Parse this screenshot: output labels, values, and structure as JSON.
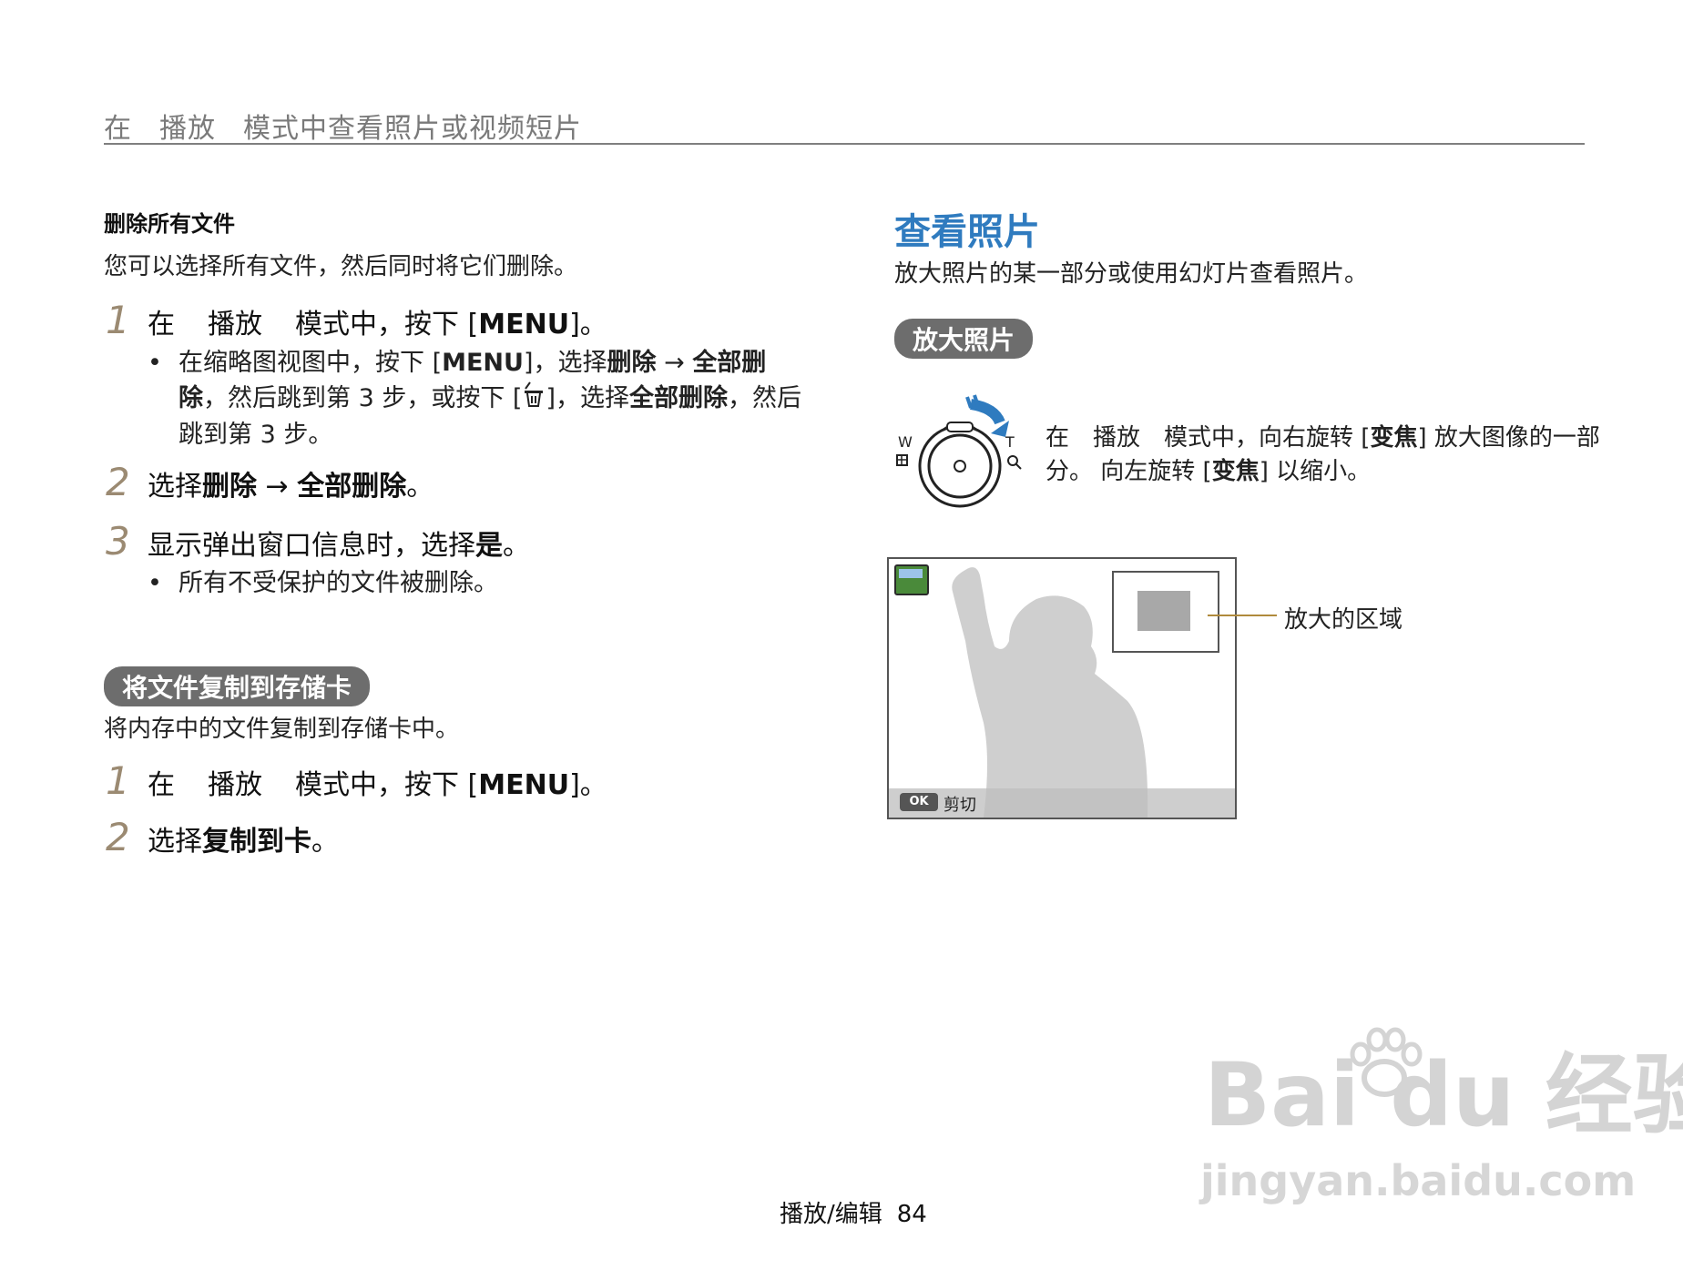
{
  "header": {
    "part1": "在",
    "part2": "播放",
    "part3": "模式中查看照片或视频短片"
  },
  "left": {
    "delete_all": {
      "title": "删除所有文件",
      "desc": "您可以选择所有文件，然后同时将它们删除。",
      "step1": {
        "num": "1",
        "pre": "在",
        "mode": "播放",
        "mid": "模式中，按下 [",
        "key": "MENU",
        "post": "]。"
      },
      "step1_bullet": {
        "l1_a": "在缩略图视图中，按下 [",
        "l1_key": "MENU",
        "l1_b": "]，选择",
        "l1_c": "删除",
        "l1_arrow": " → ",
        "l1_d": "全部删",
        "l2_a": "除",
        "l2_b": "，然后跳到第 3 步，或按下 [",
        "l2_c": "]，选择",
        "l2_d": "全部删除",
        "l2_e": "，然后",
        "l3": "跳到第 3 步。"
      },
      "step2": {
        "num": "2",
        "pre": "选择",
        "a": "删除",
        "arrow": " → ",
        "b": "全部删除",
        "post": "。"
      },
      "step3": {
        "num": "3",
        "pre": "显示弹出窗口信息时，选择",
        "a": "是",
        "post": "。"
      },
      "step3_bullet": "所有不受保护的文件被删除。"
    },
    "copy": {
      "pill": "将文件复制到存储卡",
      "desc": "将内存中的文件复制到存储卡中。",
      "step1": {
        "num": "1",
        "pre": "在",
        "mode": "播放",
        "mid": "模式中，按下 [",
        "key": "MENU",
        "post": "]。"
      },
      "step2": {
        "num": "2",
        "pre": "选择",
        "a": "复制到卡",
        "post": "。"
      }
    }
  },
  "right": {
    "title": "查看照片",
    "desc": "放大照片的某一部分或使用幻灯片查看照片。",
    "pill": "放大照片",
    "zoom": {
      "w": "W",
      "t": "T",
      "l1_a": "在",
      "l1_b": "播放",
      "l1_c": "模式中，向右旋转 [",
      "l1_d": "变焦",
      "l1_e": "] 放大图像的一部",
      "l2_a": "分。 向左旋转 [",
      "l2_b": "变焦",
      "l2_c": "] 以缩小。"
    },
    "screen": {
      "ok": "OK",
      "trim": "剪切",
      "callout": "放大的区域"
    }
  },
  "footer": {
    "section": "播放/编辑",
    "page": "84"
  },
  "watermark": {
    "brand": "Bai du 经验",
    "url": "jingyan.baidu.com"
  }
}
